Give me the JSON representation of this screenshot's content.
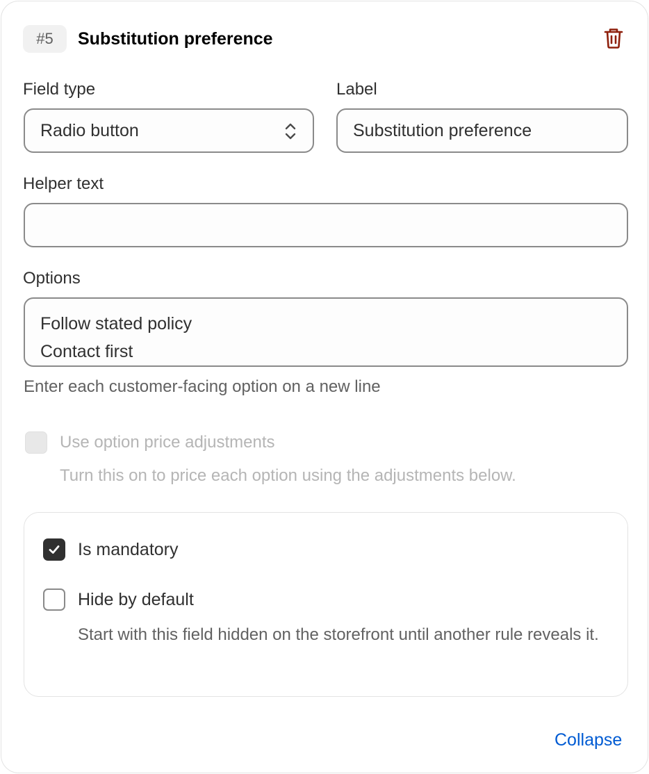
{
  "header": {
    "index_badge": "#5",
    "title": "Substitution preference"
  },
  "field_type": {
    "label": "Field type",
    "value": "Radio button"
  },
  "label_field": {
    "label": "Label",
    "value": "Substitution preference"
  },
  "helper_text": {
    "label": "Helper text",
    "value": ""
  },
  "options": {
    "label": "Options",
    "value": "Follow stated policy\nContact first",
    "hint": "Enter each customer-facing option on a new line"
  },
  "price_adjustments": {
    "label": "Use option price adjustments",
    "help": "Turn this on to price each option using the adjustments below.",
    "checked": false,
    "disabled": true
  },
  "mandatory": {
    "label": "Is mandatory",
    "checked": true
  },
  "hide_by_default": {
    "label": "Hide by default",
    "help": "Start with this field hidden on the storefront until another rule reveals it.",
    "checked": false
  },
  "footer": {
    "collapse_label": "Collapse"
  },
  "icons": {
    "delete": "trash-icon",
    "select": "select-chevrons-icon",
    "check": "checkmark-icon"
  },
  "colors": {
    "delete_icon": "#8e1f0b",
    "link": "#005bd3",
    "checkbox_checked": "#303030"
  }
}
